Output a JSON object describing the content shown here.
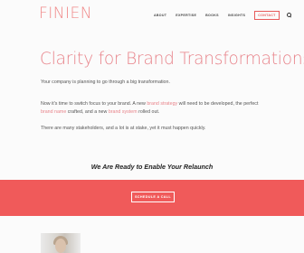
{
  "header": {
    "logo": "FINIEN",
    "nav": [
      "ABOUT",
      "EXPERTISE",
      "BOOKS",
      "INSIGHTS"
    ],
    "contact": "CONTACT"
  },
  "hero": {
    "headline": "Clarity for Brand Transformations"
  },
  "body": {
    "p1": "Your company is planning to go through a big transformation.",
    "p2_a": "Now it's time to switch focus to your brand. A new ",
    "p2_link1": "brand strategy",
    "p2_b": " will need to be developed, the perfect ",
    "p2_link2": "brand name",
    "p2_c": " crafted, and a new ",
    "p2_link3": "brand system",
    "p2_d": " rolled out.",
    "p3": "There are many stakeholders, and a lot is at stake, yet it must happen quickly."
  },
  "cta": {
    "text": "We Are Ready to Enable Your Relaunch",
    "button": "SCHEDULE A CALL"
  },
  "colors": {
    "accent": "#f05a5a",
    "headline": "#e8838a"
  }
}
